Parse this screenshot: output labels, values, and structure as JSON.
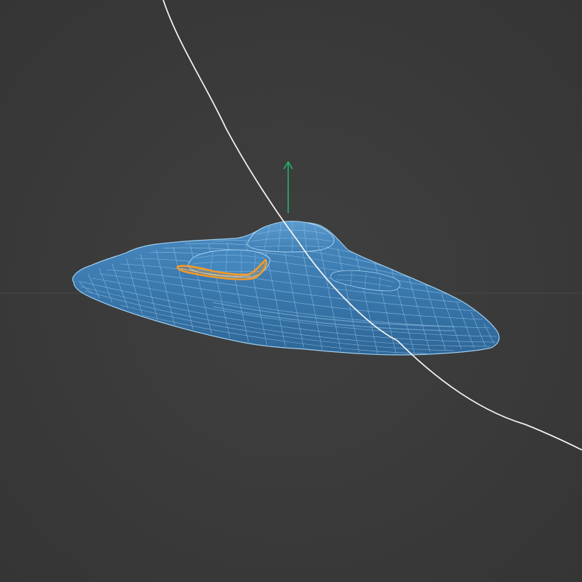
{
  "viewport": {
    "background_color": "#3b3b3b",
    "horizon_color": "#4a4a4a"
  },
  "model": {
    "name": "ufo-saucer",
    "display_mode": "wireframe-on-shaded",
    "surface_color": "#3f7fb3",
    "wire_color": "#9fd0f2",
    "selection_color": "#ff9a1f"
  },
  "gizmo": {
    "axis": "y",
    "color": "#1fb86a",
    "icon": "move-y-arrow-icon"
  },
  "curve": {
    "color": "#f2f2f2",
    "icon": "spline-curve"
  }
}
